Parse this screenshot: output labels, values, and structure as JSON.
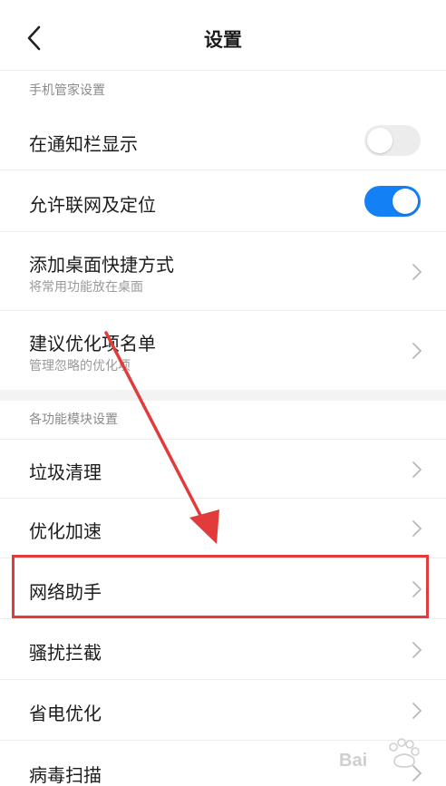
{
  "header": {
    "title": "设置"
  },
  "sections": [
    {
      "title": "手机管家设置"
    },
    {
      "title": "各功能模块设置"
    }
  ],
  "rows": {
    "notify": {
      "title": "在通知栏显示",
      "toggle": "off"
    },
    "network": {
      "title": "允许联网及定位",
      "toggle": "on"
    },
    "shortcut": {
      "title": "添加桌面快捷方式",
      "subtitle": "将常用功能放在桌面"
    },
    "suggest": {
      "title": "建议优化项名单",
      "subtitle": "管理忽略的优化项"
    },
    "junk": {
      "title": "垃圾清理"
    },
    "speed": {
      "title": "优化加速"
    },
    "netassist": {
      "title": "网络助手"
    },
    "harass": {
      "title": "骚扰拦截"
    },
    "power": {
      "title": "省电优化"
    },
    "virus": {
      "title": "病毒扫描"
    }
  },
  "colors": {
    "accent": "#1480f5",
    "annotation": "#e23b3b"
  },
  "watermark": {
    "text": "Bai",
    "icon": "baidu-paw-icon"
  }
}
